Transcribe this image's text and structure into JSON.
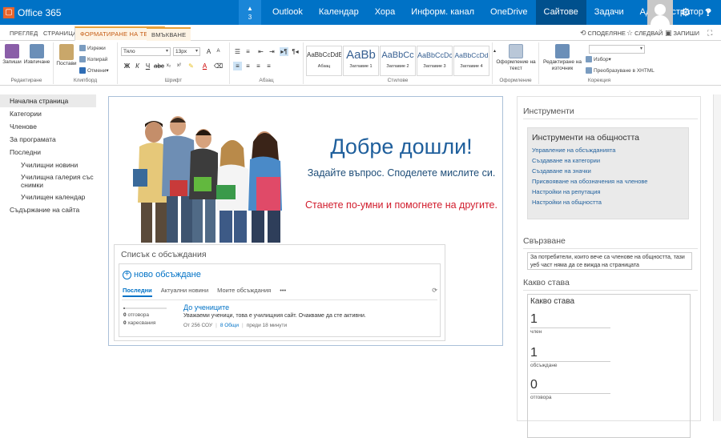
{
  "suite": {
    "logo_text": "Office 365",
    "notif_count": "3",
    "links": [
      "Outlook",
      "Календар",
      "Хора",
      "Информ. канал",
      "OneDrive",
      "Сайтове",
      "Задачи",
      "Администратор"
    ],
    "active_link": "Сайтове",
    "accent_color": "#0072c6"
  },
  "ribbon_tabs": [
    "ПРЕГЛЕД",
    "СТРАНИЦА",
    "ФОРМАТИРАНЕ НА ТЕКСТ",
    "ВМЪКВАНЕ"
  ],
  "tools": {
    "share": "СПОДЕЛЯНЕ",
    "follow": "СЛЕДВАЙ",
    "save": "ЗАПИШИ"
  },
  "ribbon": {
    "save": "Запиши",
    "checkout": "Извличане",
    "paste": "Постави",
    "cut": "Изрежи",
    "copy": "Копирай",
    "undo": "Отмени",
    "font_name": "Тяло",
    "font_size": "13px",
    "styles": [
      {
        "preview": "AaBbCcDdE",
        "name": "Абзац"
      },
      {
        "preview": "AaBb",
        "name": "Заглавие 1"
      },
      {
        "preview": "AaBbCc",
        "name": "Заглавие 2"
      },
      {
        "preview": "AaBbCcDc",
        "name": "Заглавие 3"
      },
      {
        "preview": "AaBbCcDd",
        "name": "Заглавие 4"
      }
    ],
    "text_layout": "Оформление на текст",
    "edit_source": "Редактиране на източник",
    "select": "Избор",
    "convert_xhtml": "Преобразуване в XHTML",
    "groups": [
      "Редактиране",
      "Клипборд",
      "Шрифт",
      "Абзац",
      "Стилове",
      "Оформление",
      "Корекция"
    ]
  },
  "leftnav": [
    {
      "label": "Начална страница",
      "sub": false,
      "selected": true
    },
    {
      "label": "Категории",
      "sub": false
    },
    {
      "label": "Членове",
      "sub": false
    },
    {
      "label": "За програмата",
      "sub": false
    },
    {
      "label": "Последни",
      "sub": false
    },
    {
      "label": "Училищни новини",
      "sub": true
    },
    {
      "label": "Училищна галерия със снимки",
      "sub": true
    },
    {
      "label": "Училищен календар",
      "sub": true
    },
    {
      "label": "Съдържание на сайта",
      "sub": false
    }
  ],
  "welcome": {
    "title": "Добре дошли!",
    "line1": "Задайте въпрос. Споделете мислите си.",
    "line2": "Станете по-умни и помогнете на другите."
  },
  "discussions": {
    "title": "Списък с обсъждания",
    "new": "ново обсъждане",
    "tabs": [
      "Последни",
      "Актуални новини",
      "Моите обсъждания",
      "•••"
    ],
    "item": {
      "replies_count": "0",
      "replies_label": "отговора",
      "likes_count": "0",
      "likes_label": "харесвания",
      "title": "До учениците",
      "text": "Уважаеми ученици, това е училищния сайт. Очакваме да сте активни.",
      "author_prefix": "От",
      "author": "256 СОУ",
      "category": "8 Общи",
      "time": "преди 18 минути"
    }
  },
  "right": {
    "tools_title": "Инструменти",
    "tools_box_title": "Инструменти на общността",
    "tools_links": [
      "Управление на обсъжданията",
      "Създаване на категории",
      "Създаване на значки",
      "Присвояване на обозначения на членове",
      "Настройки на репутация",
      "Настройки на общността"
    ],
    "join_title": "Свързване",
    "join_text": "За потребители, които вече са членове на общността, тази уеб част няма да се вижда на страницата",
    "whats_title": "Какво става",
    "whats_box_title": "Какво става",
    "stats": [
      {
        "num": "1",
        "label": "член"
      },
      {
        "num": "1",
        "label": "обсъждане"
      },
      {
        "num": "0",
        "label": "отговора"
      }
    ]
  }
}
